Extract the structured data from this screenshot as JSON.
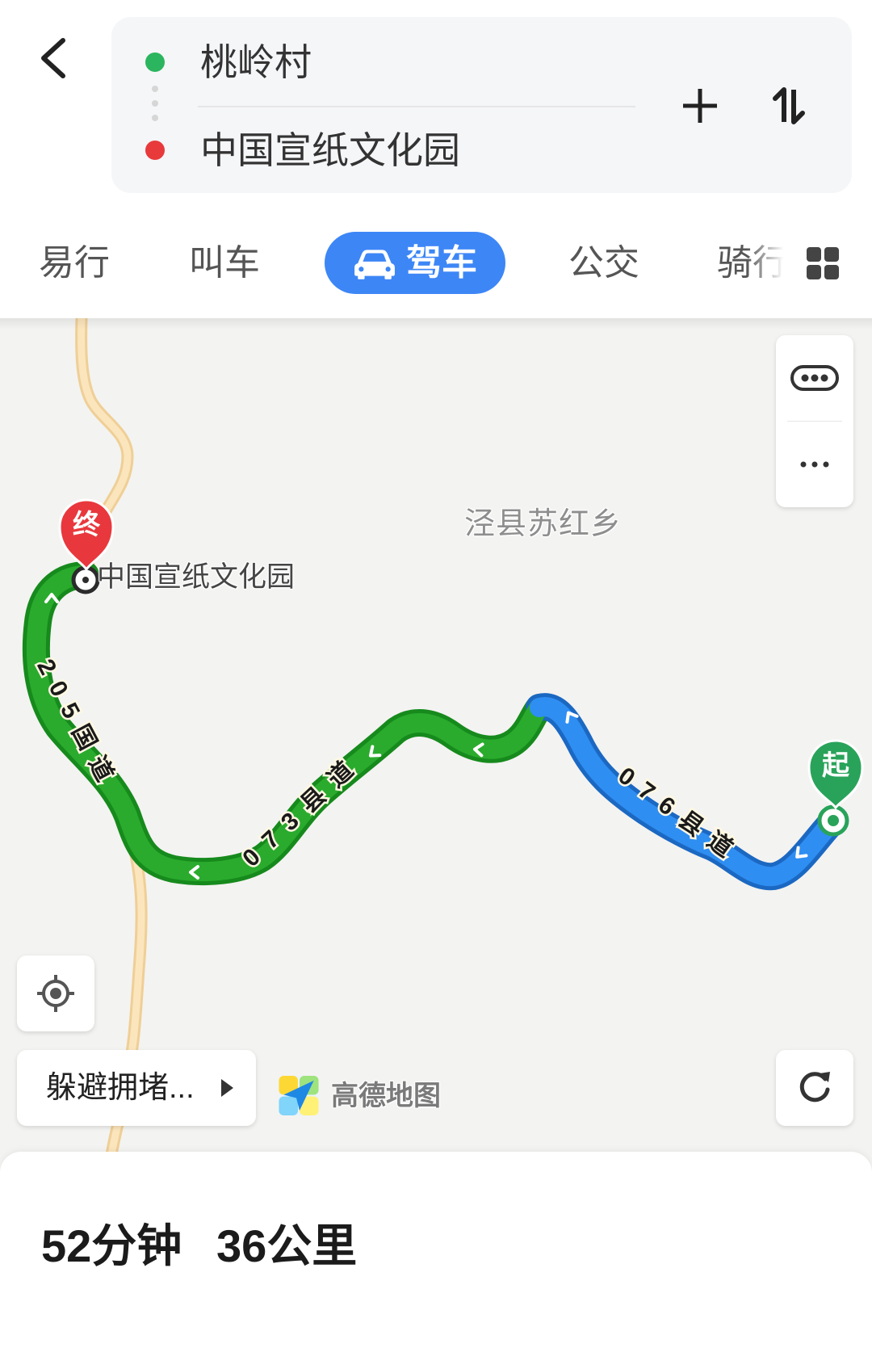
{
  "header": {
    "origin": "桃岭村",
    "destination": "中国宣纸文化园"
  },
  "modes": [
    {
      "label": "易行",
      "selected": false
    },
    {
      "label": "叫车",
      "selected": false
    },
    {
      "label": "驾车",
      "selected": true
    },
    {
      "label": "公交",
      "selected": false
    },
    {
      "label": "骑行",
      "selected": false
    }
  ],
  "map": {
    "area_label": "泾县苏红乡",
    "destination_label": "中国宣纸文化园",
    "end_marker": "终",
    "start_marker": "起",
    "roads": [
      {
        "name": "205国道",
        "route_color": "#2aab2d"
      },
      {
        "name": "073县道",
        "route_color": "#2aab2d"
      },
      {
        "name": "076县道",
        "route_color": "#2f8ef2"
      }
    ],
    "logo_text": "高德地图"
  },
  "controls": {
    "avoid_congestion": "躲避拥堵..."
  },
  "summary": {
    "duration": "52分钟",
    "distance": "36公里"
  },
  "icons": {
    "back": "chevron-left-icon",
    "add_waypoint": "plus-icon",
    "swap": "swap-icon",
    "driving": "car-icon",
    "more_modes": "grid-icon",
    "traffic": "traffic-icon",
    "more": "more-dots-icon",
    "locate": "locate-icon",
    "refresh": "refresh-icon",
    "avoid_arrow": "triangle-right-icon",
    "logo": "amap-logo-icon"
  },
  "colors": {
    "accent": "#3d86f6",
    "origin_dot": "#2bb55e",
    "destination_dot": "#e8393b",
    "end_pin": "#e8383d",
    "start_pin": "#29a35a",
    "route_green": "#2aab2d",
    "route_blue": "#2f8ef2",
    "road_yellow": "#fbe5bd"
  }
}
